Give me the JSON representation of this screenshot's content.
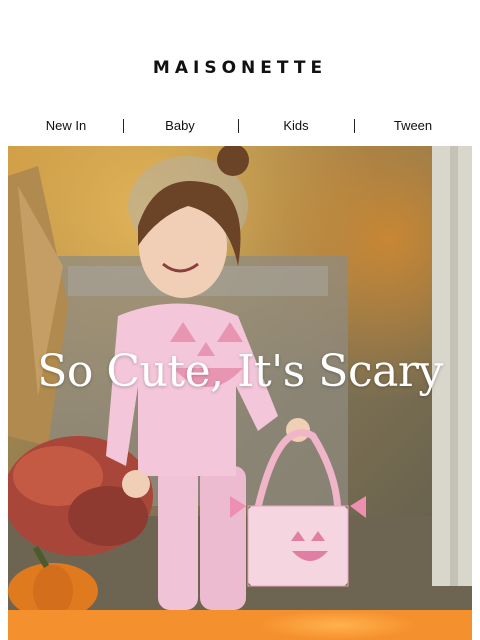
{
  "brand": {
    "name": "MAISONETTE"
  },
  "nav": {
    "items": [
      "New In",
      "Baby",
      "Kids",
      "Tween"
    ]
  },
  "hero": {
    "title": "So Cute, It's Scary"
  },
  "colors": {
    "text": "#111111",
    "band": "#f5902e",
    "outfit_pink": "#f0c3d6"
  }
}
